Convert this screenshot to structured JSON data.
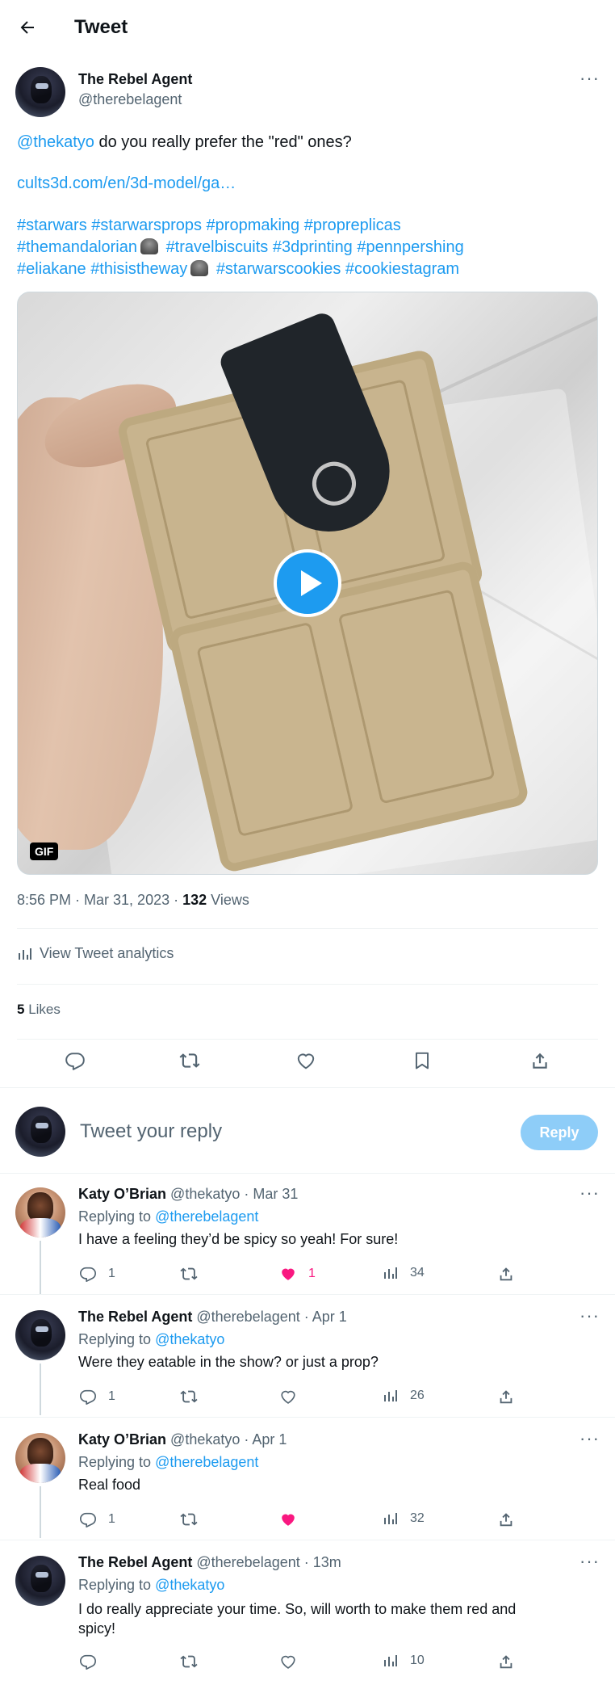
{
  "header": {
    "title": "Tweet"
  },
  "tweet": {
    "author_name": "The Rebel Agent",
    "author_handle": "@therebelagent",
    "mention": "@thekatyo",
    "text": "do you really prefer the \"red\" ones?",
    "link": "cults3d.com/en/3d-model/ga…",
    "hashtags_line1": [
      "#starwars",
      "#starwarsprops",
      "#propmaking",
      "#propreplicas"
    ],
    "hashtags_line2": [
      "#themandalorian",
      "#travelbiscuits",
      "#3dprinting",
      "#pennpershing"
    ],
    "hashtags_line3": [
      "#eliakane",
      "#thisistheway",
      "#starwarscookies",
      "#cookiestagram"
    ],
    "media_badge": "GIF",
    "time": "8:56 PM · Mar 31, 2023 · ",
    "views_count": "132",
    "views_label": " Views",
    "analytics": "View Tweet analytics",
    "likes_count": "5",
    "likes_label": " Likes"
  },
  "composer": {
    "placeholder": "Tweet your reply",
    "button": "Reply"
  },
  "replies": [
    {
      "name": "Katy O’Brian",
      "handle": "@thekatyo",
      "time": "· Mar 31",
      "replying_prefix": "Replying to ",
      "replying_to": "@therebelagent",
      "text": "I have a feeling they’d be spicy so yeah! For sure!",
      "replies": "1",
      "retweets": "",
      "likes": "1",
      "liked": true,
      "views": "34"
    },
    {
      "name": "The Rebel Agent",
      "handle": "@therebelagent",
      "time": "· Apr 1",
      "replying_prefix": "Replying to ",
      "replying_to": "@thekatyo",
      "text": "Were they eatable in the show? or just a prop?",
      "replies": "1",
      "retweets": "",
      "likes": "",
      "liked": false,
      "views": "26"
    },
    {
      "name": "Katy O’Brian",
      "handle": "@thekatyo",
      "time": "· Apr 1",
      "replying_prefix": "Replying to ",
      "replying_to": "@therebelagent",
      "text": "Real food",
      "replies": "1",
      "retweets": "",
      "likes": "",
      "liked": true,
      "views": "32"
    },
    {
      "name": "The Rebel Agent",
      "handle": "@therebelagent",
      "time": "· 13m",
      "replying_prefix": "Replying to ",
      "replying_to": "@thekatyo",
      "text_line1": "I do really appreciate your time. So, will worth to make them red and",
      "text_line2": "spicy!",
      "replies": "",
      "retweets": "",
      "likes": "",
      "liked": false,
      "views": "10"
    }
  ],
  "colors": {
    "accent": "#1d9bf0",
    "like": "#f91880",
    "muted": "#536471",
    "reply_button": "#8ecdf8"
  },
  "icons": [
    "back-arrow-icon",
    "more-icon",
    "analytics-icon",
    "reply-icon",
    "retweet-icon",
    "like-icon",
    "bookmark-icon",
    "share-icon",
    "views-icon",
    "play-icon"
  ]
}
